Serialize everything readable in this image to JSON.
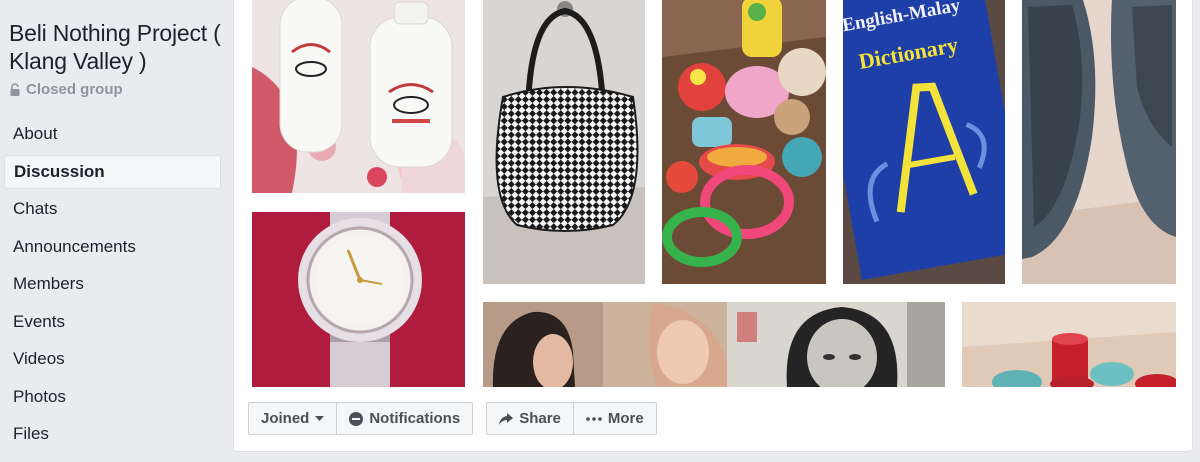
{
  "sidebar": {
    "group_title": "Beli Nothing Project ( Klang Valley )",
    "privacy": "Closed group",
    "nav_items": [
      {
        "label": "About",
        "active": false
      },
      {
        "label": "Discussion",
        "active": true
      },
      {
        "label": "Chats",
        "active": false
      },
      {
        "label": "Announcements",
        "active": false
      },
      {
        "label": "Members",
        "active": false
      },
      {
        "label": "Events",
        "active": false
      },
      {
        "label": "Videos",
        "active": false
      },
      {
        "label": "Photos",
        "active": false
      },
      {
        "label": "Files",
        "active": false
      }
    ]
  },
  "cover": {
    "photos": [
      {
        "subject": "white bottles"
      },
      {
        "subject": "checkered handbag"
      },
      {
        "subject": "baby toys"
      },
      {
        "subject": "English-Malay dictionary"
      },
      {
        "subject": "grey shoes"
      },
      {
        "subject": "wrist watch"
      },
      {
        "subject": "portrait picture"
      },
      {
        "subject": "old photograph"
      },
      {
        "subject": "candles"
      }
    ],
    "dictionary_text": {
      "line1": "English-Malay",
      "line2": "Dictionary"
    }
  },
  "actions": {
    "joined_label": "Joined",
    "notifications_label": "Notifications",
    "share_label": "Share",
    "more_label": "More"
  },
  "colors": {
    "background": "#e9ebee",
    "card": "#ffffff",
    "button_bg": "#f5f6f7",
    "button_text": "#4b4f56",
    "muted": "#90949c"
  }
}
